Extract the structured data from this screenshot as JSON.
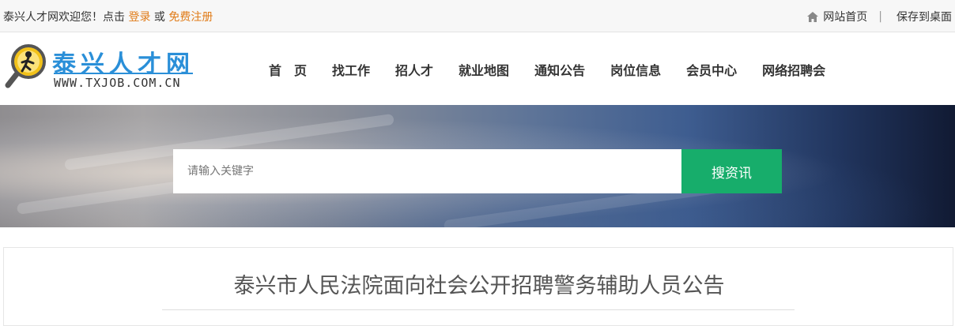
{
  "topbar": {
    "welcome": "泰兴人才网欢迎您！点击",
    "login": "登录",
    "or": "或",
    "register": "免费注册",
    "home_link": "网站首页",
    "separator": "|",
    "save_desktop": "保存到桌面"
  },
  "logo": {
    "title": "泰兴人才网",
    "url": "WWW.TXJOB.COM.CN"
  },
  "nav": {
    "items": [
      "首　页",
      "找工作",
      "招人才",
      "就业地图",
      "通知公告",
      "岗位信息",
      "会员中心",
      "网络招聘会"
    ]
  },
  "search": {
    "placeholder": "请输入关键字",
    "button": "搜资讯"
  },
  "article": {
    "title": "泰兴市人民法院面向社会公开招聘警务辅助人员公告"
  },
  "colors": {
    "accent_green": "#17ad6b",
    "link_orange": "#e07b18",
    "logo_blue": "#2a8fd8"
  }
}
